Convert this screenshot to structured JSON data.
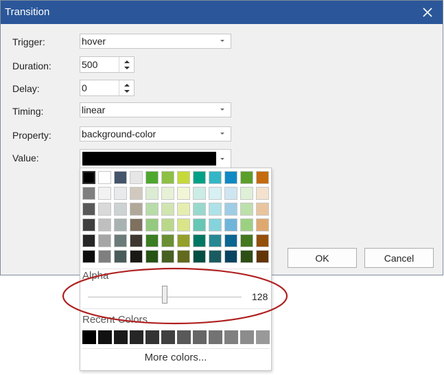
{
  "dialog": {
    "title": "Transition",
    "close_icon": "close-icon",
    "ok_label": "OK",
    "cancel_label": "Cancel"
  },
  "form": {
    "trigger": {
      "label": "Trigger:",
      "value": "hover"
    },
    "duration": {
      "label": "Duration:",
      "value": "500"
    },
    "delay": {
      "label": "Delay:",
      "value": "0"
    },
    "timing": {
      "label": "Timing:",
      "value": "linear"
    },
    "property": {
      "label": "Property:",
      "value": "background-color"
    },
    "value": {
      "label": "Value:",
      "color": "#000000"
    }
  },
  "picker": {
    "palette": [
      [
        "#000000",
        "#ffffff",
        "#44546a",
        "#e7e6e6",
        "#4ea72e",
        "#8dc043",
        "#c6d93a",
        "#00a186",
        "#34b6c6",
        "#0f89c4",
        "#5b9f2b",
        "#c46b0f"
      ],
      [
        "#7f7f7f",
        "#f2f2f2",
        "#e8eaec",
        "#d1c9bd",
        "#dbecd3",
        "#e7f1d7",
        "#f2f6d6",
        "#ccece6",
        "#d6f0f3",
        "#cfe6f2",
        "#def0d5",
        "#f4e2cf"
      ],
      [
        "#595959",
        "#d9d9d9",
        "#cdd2d3",
        "#b0a898",
        "#b8dca9",
        "#d1e5b1",
        "#e6eeaf",
        "#99d9cd",
        "#aee2e8",
        "#9fcde6",
        "#bde0ab",
        "#e9c59f"
      ],
      [
        "#3f3f3f",
        "#bfbfbf",
        "#a8b2b1",
        "#7f705f",
        "#95c97e",
        "#bad88a",
        "#d9e587",
        "#66c7b4",
        "#85d3dc",
        "#6fb4d9",
        "#9cd181",
        "#dfa86f"
      ],
      [
        "#262626",
        "#a5a5a5",
        "#6b7b79",
        "#3e3830",
        "#3a7d22",
        "#6a9033",
        "#949f2c",
        "#017864",
        "#278894",
        "#0b6692",
        "#437720",
        "#93500b"
      ],
      [
        "#0c0c0c",
        "#7f7f7f",
        "#4a5c5a",
        "#1b1915",
        "#275315",
        "#476022",
        "#636a1d",
        "#014f43",
        "#1a5b62",
        "#074461",
        "#2d4f15",
        "#623507"
      ]
    ],
    "selected_color": "#000000",
    "alpha_title": "Alpha",
    "alpha_fraction": 0.5,
    "alpha_value": "128",
    "recent_title": "Recent Colors",
    "recent_colors": [
      "#000000",
      "#111111",
      "#1a1a1a",
      "#262626",
      "#333333",
      "#404040",
      "#595959",
      "#666666",
      "#737373",
      "#808080",
      "#8c8c8c",
      "#999999"
    ],
    "more_label": "More colors..."
  },
  "annotation": {
    "color": "#b02020"
  }
}
